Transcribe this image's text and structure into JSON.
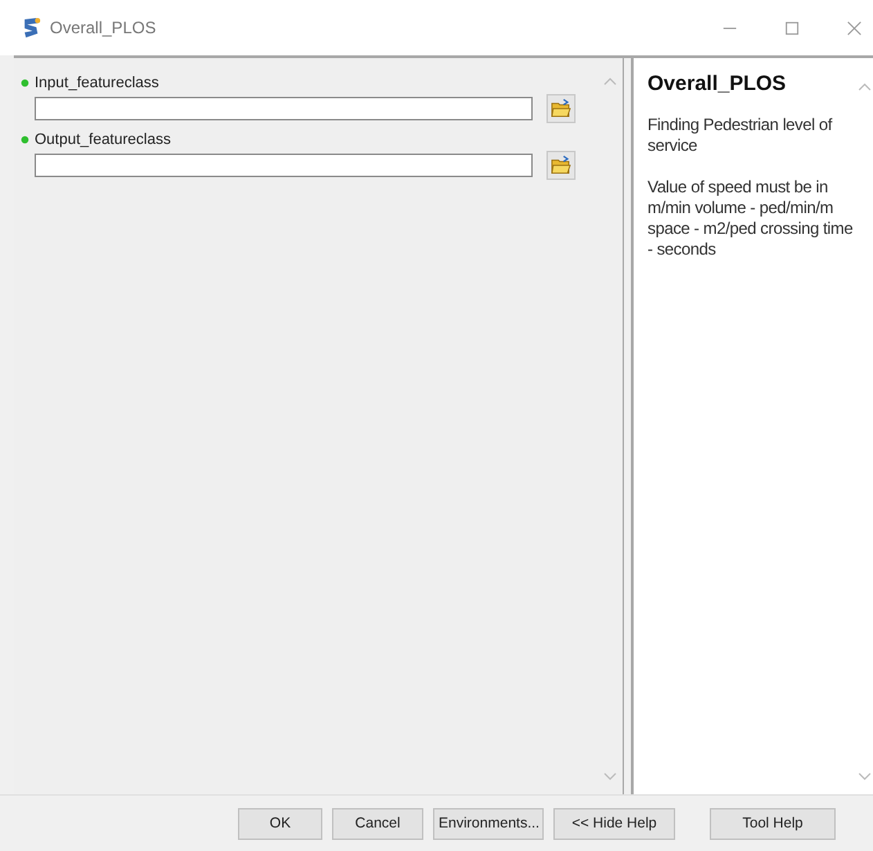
{
  "window": {
    "title": "Overall_PLOS"
  },
  "parameters": [
    {
      "label": "Input_featureclass",
      "required": true
    },
    {
      "label": "Output_featureclass",
      "required": true
    }
  ],
  "help": {
    "title": "Overall_PLOS",
    "paragraphs": [
      "Finding Pedestrian level of service",
      "Value of speed must be in m/min volume - ped/min/m space - m2/ped crossing time - seconds"
    ]
  },
  "buttons": [
    "OK",
    "Cancel",
    "Environments...",
    "<< Hide Help"
  ],
  "help_button": "Tool Help"
}
